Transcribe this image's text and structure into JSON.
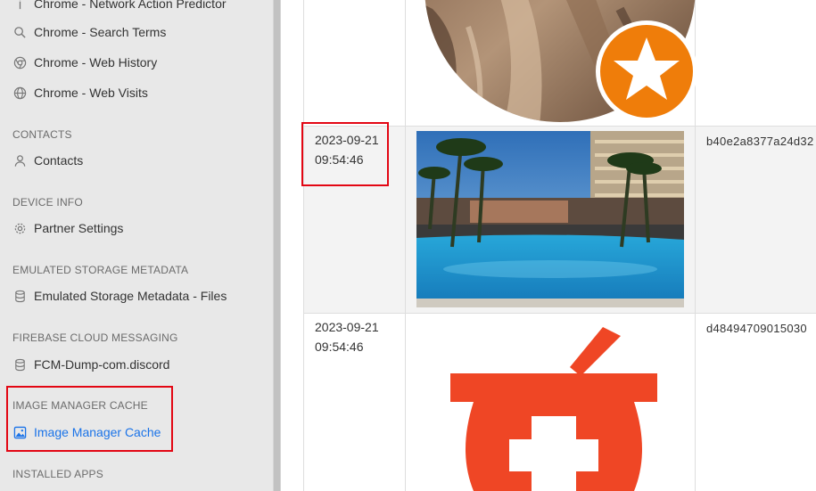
{
  "sidebar": {
    "items_top": [
      {
        "label": "Chrome - Network Action Predictor",
        "icon": "info-icon"
      },
      {
        "label": "Chrome - Search Terms",
        "icon": "search-icon"
      },
      {
        "label": "Chrome - Web History",
        "icon": "chrome-icon"
      },
      {
        "label": "Chrome - Web Visits",
        "icon": "globe-icon"
      }
    ],
    "sections": {
      "contacts": {
        "title": "CONTACTS",
        "item": "Contacts"
      },
      "device_info": {
        "title": "DEVICE INFO",
        "item": "Partner Settings"
      },
      "emulated": {
        "title": "EMULATED STORAGE METADATA",
        "item": "Emulated Storage Metadata - Files"
      },
      "firebase": {
        "title": "FIREBASE CLOUD MESSAGING",
        "item": "FCM-Dump-com.discord"
      },
      "image_cache": {
        "title": "IMAGE MANAGER CACHE",
        "item": "Image Manager Cache"
      },
      "installed": {
        "title": "INSTALLED APPS"
      }
    }
  },
  "table": {
    "rows": [
      {
        "date": "2023-09-21",
        "time": "09:54:46",
        "hash": "b40e2a8377a24d32",
        "image": "pool-photo"
      },
      {
        "date": "2023-09-21",
        "time": "09:54:46",
        "hash": "d48494709015030",
        "image": "pharmacy-icon"
      }
    ]
  },
  "colors": {
    "accent": "#1a73e8",
    "highlight": "#e30613",
    "sidebar_bg": "#e8e8e8"
  }
}
